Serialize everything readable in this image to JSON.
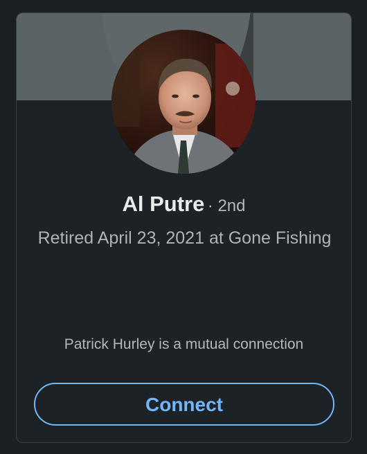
{
  "profile": {
    "name": "Al Putre",
    "degree": "· 2nd",
    "headline": "Retired April 23, 2021 at Gone Fishing",
    "mutual": "Patrick Hurley is a mutual connection",
    "avatar_icon": "profile-photo"
  },
  "actions": {
    "connect_label": "Connect"
  },
  "colors": {
    "accent": "#71b7fb",
    "background": "#1b1f23",
    "card": "#1d2226"
  }
}
